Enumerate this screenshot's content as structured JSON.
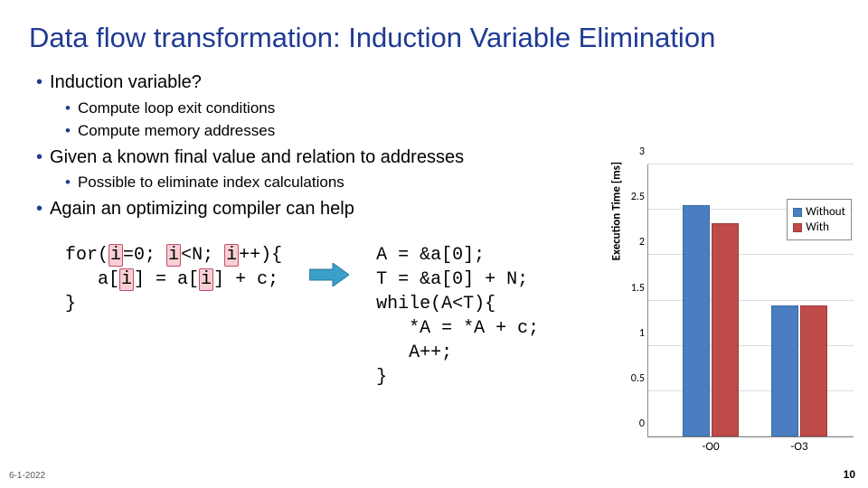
{
  "title": "Data flow transformation: Induction Variable Elimination",
  "bullets": {
    "b1a": "Induction variable?",
    "b2a": "Compute loop exit conditions",
    "b2b": "Compute memory addresses",
    "b1b": "Given a known final value and relation to addresses",
    "b2c": "Possible to eliminate index calculations",
    "b1c": "Again an optimizing compiler can help"
  },
  "code_left": {
    "l1a": "for(",
    "l1b": "i",
    "l1c": "=0; ",
    "l1d": "i",
    "l1e": "<N; ",
    "l1f": "i",
    "l1g": "++){",
    "l2a": "   a[",
    "l2b": "i",
    "l2c": "] = a[",
    "l2d": "i",
    "l2e": "] + c;",
    "l3": "}"
  },
  "code_right": {
    "l1": "A = &a[0];",
    "l2": "T = &a[0] + N;",
    "l3": "while(A<T){",
    "l4": "   *A = *A + c;",
    "l5": "   A++;",
    "l6": "}"
  },
  "chart_data": {
    "type": "bar",
    "title": "",
    "xlabel": "",
    "ylabel": "Execution Time [ms]",
    "ylim": [
      0,
      3
    ],
    "yticks": [
      0,
      0.5,
      1,
      1.5,
      2,
      2.5,
      3
    ],
    "categories": [
      "-O0",
      "-O3"
    ],
    "series": [
      {
        "name": "Without",
        "values": [
          2.55,
          1.45
        ],
        "color": "#4a7ec0"
      },
      {
        "name": "With",
        "values": [
          2.35,
          1.45
        ],
        "color": "#be4b48"
      }
    ],
    "legend_position": "right"
  },
  "footer": {
    "date": "6-1-2022",
    "page": "10"
  }
}
